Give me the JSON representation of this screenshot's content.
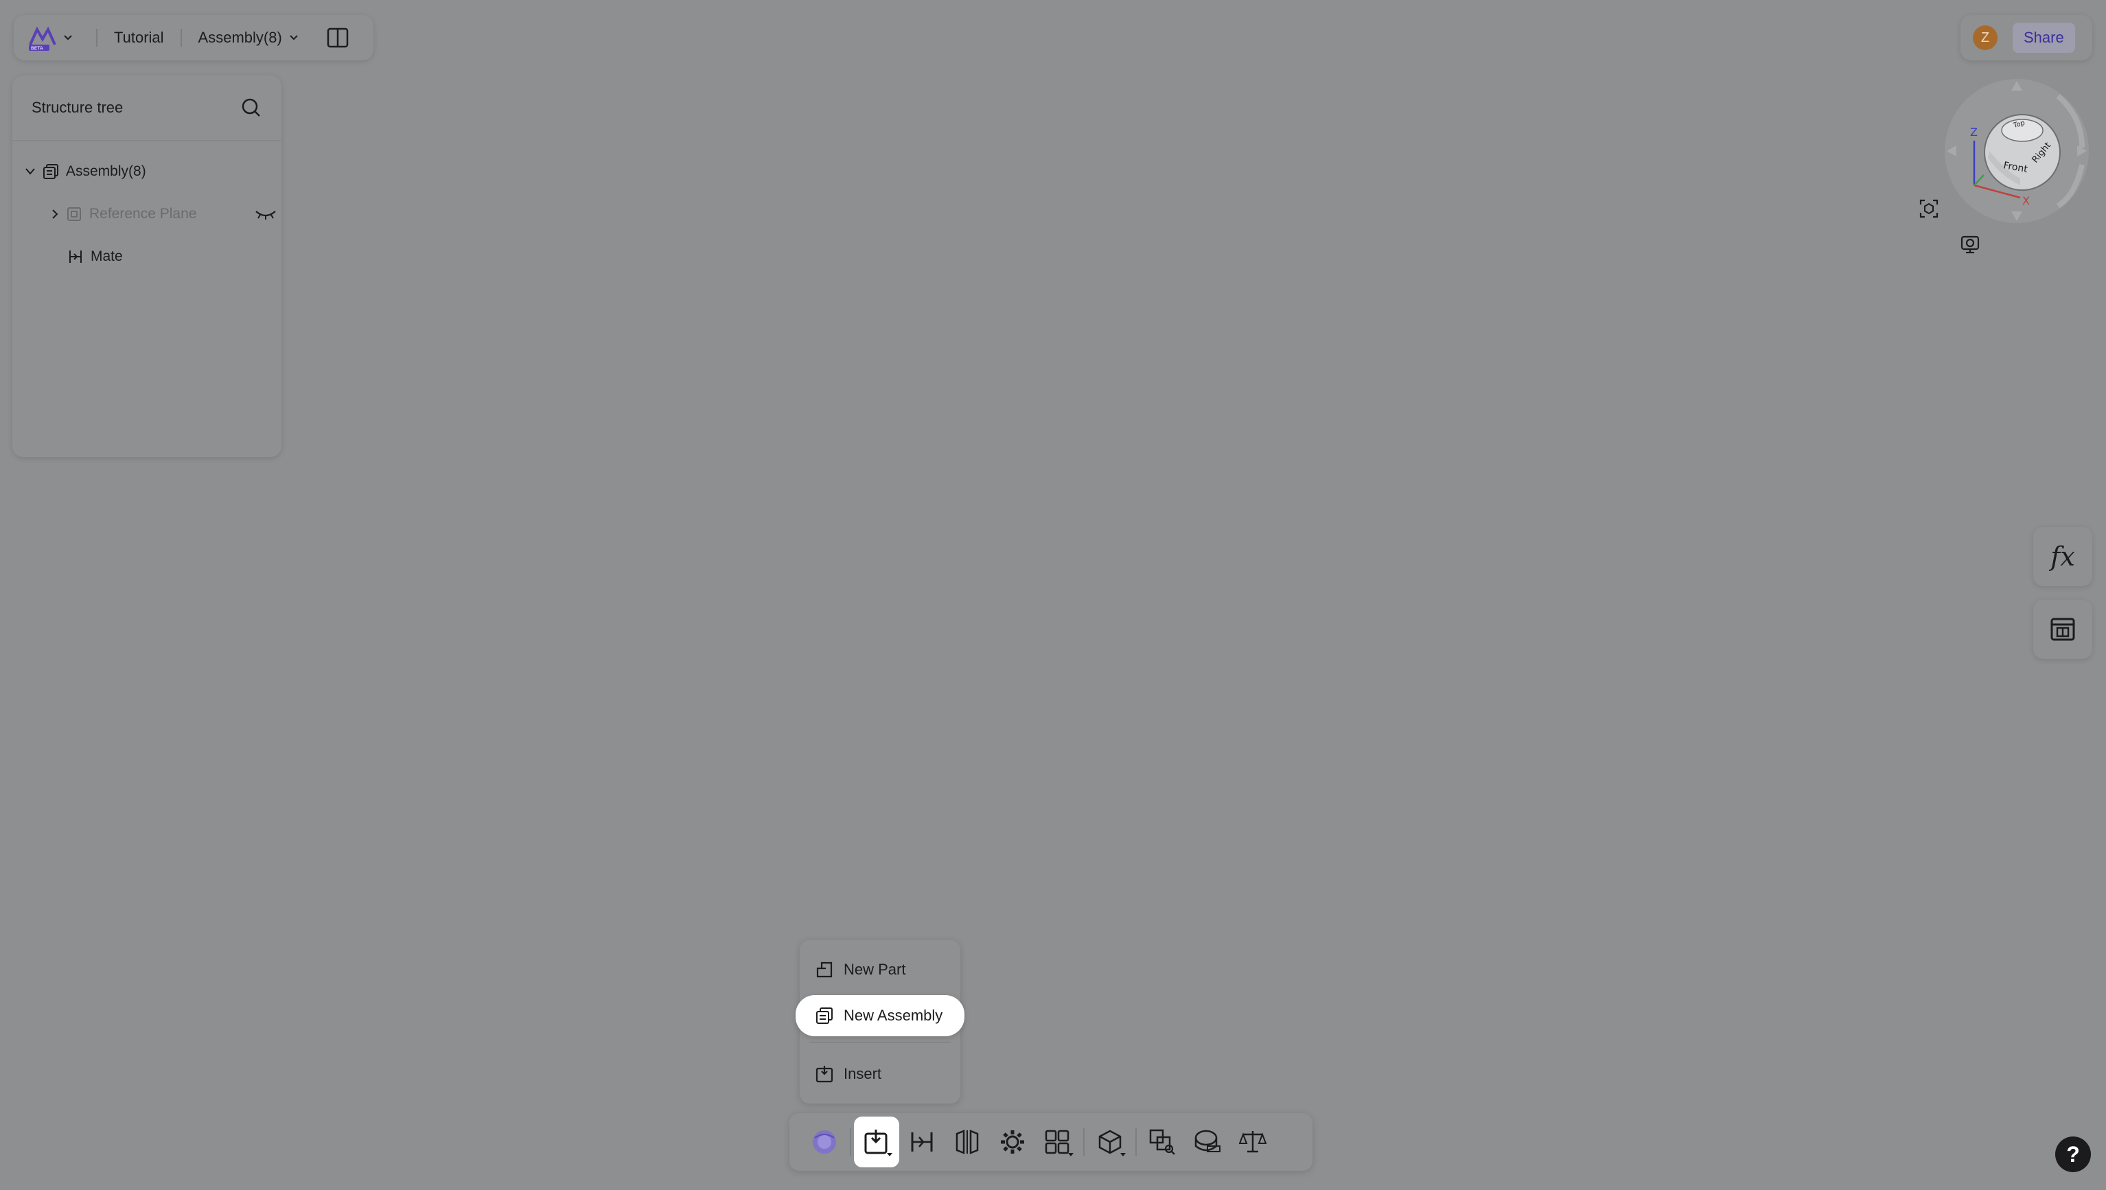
{
  "topbar": {
    "project": "Tutorial",
    "document": "Assembly(8)",
    "logo_badge": "BETA"
  },
  "share": {
    "avatar_initial": "Z",
    "share_label": "Share"
  },
  "tree": {
    "title": "Structure tree",
    "items": [
      {
        "label": "Assembly(8)"
      },
      {
        "label": "Reference Plane"
      },
      {
        "label": "Mate"
      }
    ]
  },
  "viewcube": {
    "face_front": "Front",
    "face_right": "Right",
    "face_top": "Top",
    "axis_x": "X",
    "axis_z": "Z"
  },
  "side": {
    "fx_label": "fx"
  },
  "menu": {
    "items": [
      {
        "label": "New Part"
      },
      {
        "label": "New Assembly"
      },
      {
        "label": "Insert"
      }
    ]
  },
  "help": {
    "label": "?"
  },
  "colors": {
    "background": "#8e8f91",
    "accent": "#3a2f9e",
    "avatar": "#a86a2a"
  }
}
